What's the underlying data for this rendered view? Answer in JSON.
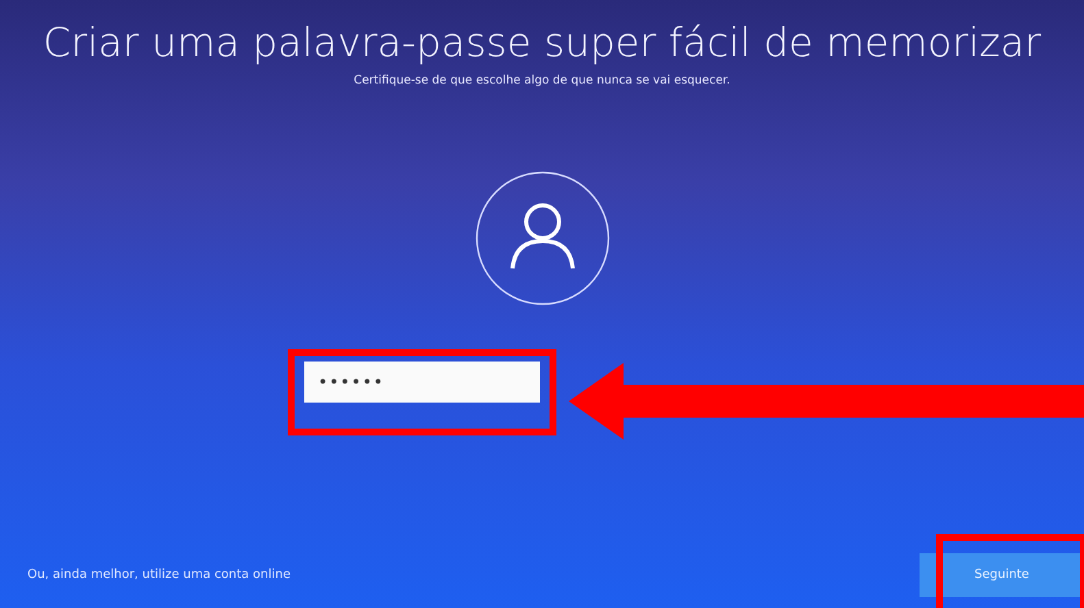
{
  "title": "Criar uma palavra-passe super fácil de memorizar",
  "subtitle": "Certifique-se de que escolhe algo de que nunca se vai esquecer.",
  "password_field": {
    "value": "••••••"
  },
  "online_account_link": "Ou, ainda melhor, utilize uma conta online",
  "buttons": [
    {
      "label": "Seguinte"
    }
  ]
}
